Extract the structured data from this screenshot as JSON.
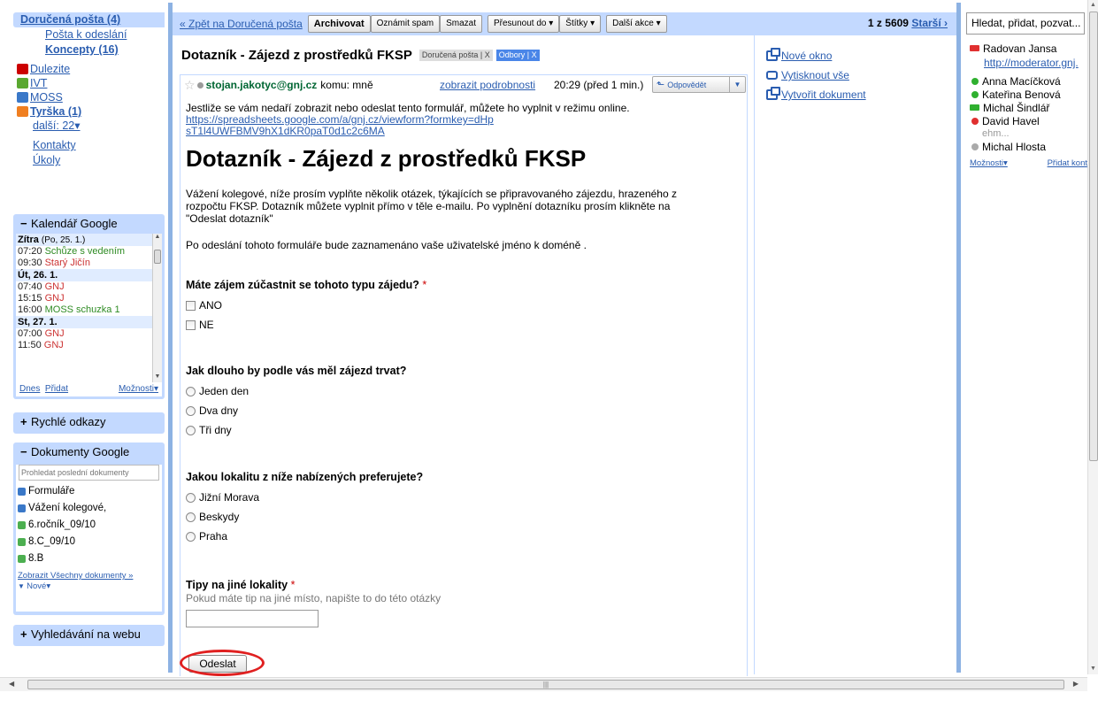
{
  "nav": {
    "inbox": "Doručená pošta (4)",
    "outbox": "Pošta k odeslání",
    "drafts": "Koncepty (16)",
    "labels": [
      {
        "name": "Dulezite",
        "color": "#cc0000",
        "bold": false
      },
      {
        "name": "IVT",
        "color": "#5aa830",
        "bold": false
      },
      {
        "name": "MOSS",
        "color": "#3a78c8",
        "bold": false
      },
      {
        "name": "Tyrška (1)",
        "color": "#f07f20",
        "bold": true
      }
    ],
    "more": "další: 22▾",
    "contacts": "Kontakty",
    "tasks": "Úkoly"
  },
  "calendar": {
    "title": "Kalendář Google",
    "days": [
      {
        "label": "Zítra",
        "sub": "(Po, 25. 1.)",
        "events": [
          {
            "time": "07:20",
            "name": "Schůze s vedením",
            "color": "green"
          },
          {
            "time": "09:30",
            "name": "Starý Jičín",
            "color": "red"
          }
        ]
      },
      {
        "label": "Út, 26. 1.",
        "sub": "",
        "events": [
          {
            "time": "07:40",
            "name": "GNJ",
            "color": "red"
          },
          {
            "time": "15:15",
            "name": "GNJ",
            "color": "red"
          },
          {
            "time": "16:00",
            "name": "MOSS schuzka 1",
            "color": "green"
          }
        ]
      },
      {
        "label": "St, 27. 1.",
        "sub": "",
        "events": [
          {
            "time": "07:00",
            "name": "GNJ",
            "color": "red"
          },
          {
            "time": "11:50",
            "name": "GNJ",
            "color": "red"
          }
        ]
      }
    ],
    "today": "Dnes",
    "add": "Přidat",
    "options": "Možnosti▾"
  },
  "quick_links": {
    "title": "Rychlé odkazy"
  },
  "docs": {
    "title": "Dokumenty Google",
    "search_placeholder": "Prohledat poslední dokumenty",
    "items": [
      {
        "name": "Formuláře",
        "color": "#3a78c8"
      },
      {
        "name": "Vážení kolegové,",
        "color": "#3a78c8"
      },
      {
        "name": "6.ročník_09/10",
        "color": "#4caf50"
      },
      {
        "name": "8.C_09/10",
        "color": "#4caf50"
      },
      {
        "name": "8.B",
        "color": "#4caf50"
      }
    ],
    "show_all": "Zobrazit Všechny dokumenty »",
    "new": "Nové▾"
  },
  "web_search": {
    "title": "Vyhledávání na webu"
  },
  "toolbar": {
    "back": "« Zpět na Doručená pošta",
    "archive": "Archivovat",
    "spam": "Oznámit spam",
    "delete": "Smazat",
    "move": "Přesunout do ▾",
    "labels": "Štítky ▾",
    "more": "Další akce ▾",
    "count": "1 z 5609",
    "older": "Starší ›"
  },
  "message": {
    "subject": "Dotazník - Zájezd z prostředků FKSP",
    "label1": "Doručená pošta | X",
    "label2": "Odbory | X",
    "from": "stojan.jakotyc@gnj.cz",
    "to": "komu: mně",
    "details": "zobrazit podrobnosti",
    "time": "20:29 (před 1 min.)",
    "reply": "Odpovědět",
    "intro": "Jestliže se vám nedaří zobrazit nebo odeslat tento formulář, můžete ho vyplnit v režimu online.",
    "link": "https://spreadsheets.google.com/a/gnj.cz/viewform?formkey=dHpsT1l4UWFBMV9hX1dKR0paT0d1c2c6MA"
  },
  "form": {
    "title": "Dotazník - Zájezd z prostředků FKSP",
    "description": "Vážení kolegové, níže prosím vyplňte několik otázek, týkajících se připravovaného zájezdu, hrazeného z rozpočtu FKSP. Dotazník můžete vyplnit přímo v těle e-mailu. Po vyplnění dotazníku prosím klikněte na \"Odeslat dotazník\"",
    "note": "Po odeslání tohoto formuláře bude zaznamenáno vaše uživatelské jméno k doméně .",
    "q1": {
      "title": "Máte zájem zúčastnit se tohoto typu zájedu?",
      "required": "*",
      "options": [
        "ANO",
        "NE"
      ]
    },
    "q2": {
      "title": "Jak dlouho by podle vás měl zájezd trvat?",
      "options": [
        "Jeden den",
        "Dva dny",
        "Tři dny"
      ]
    },
    "q3": {
      "title": "Jakou lokalitu z níže nabízených preferujete?",
      "options": [
        "Jižní Morava",
        "Beskydy",
        "Praha"
      ]
    },
    "q4": {
      "title": "Tipy na jiné lokality",
      "required": "*",
      "help": "Pokud máte tip na jiné místo, napište to do této otázky",
      "value": ""
    },
    "submit": "Odeslat"
  },
  "actions": {
    "new_window": "Nové okno",
    "print_all": "Vytisknout vše",
    "create_doc": "Vytvořit dokument"
  },
  "chat": {
    "search": "Hledat, přidat, pozvat...",
    "top": {
      "name": "Radovan Jansa",
      "link": "http://moderator.gnj."
    },
    "contacts": [
      {
        "name": "Anna Macíčková",
        "status": "green"
      },
      {
        "name": "Kateřina Benová",
        "status": "green"
      },
      {
        "name": "Michal Šindlář",
        "status": "cam-green"
      },
      {
        "name": "David Havel",
        "status": "red"
      }
    ],
    "status_text": "ehm...",
    "last": {
      "name": "Michal Hlosta",
      "status": "gray"
    },
    "options": "Možnosti▾",
    "add": "Přidat kont"
  }
}
